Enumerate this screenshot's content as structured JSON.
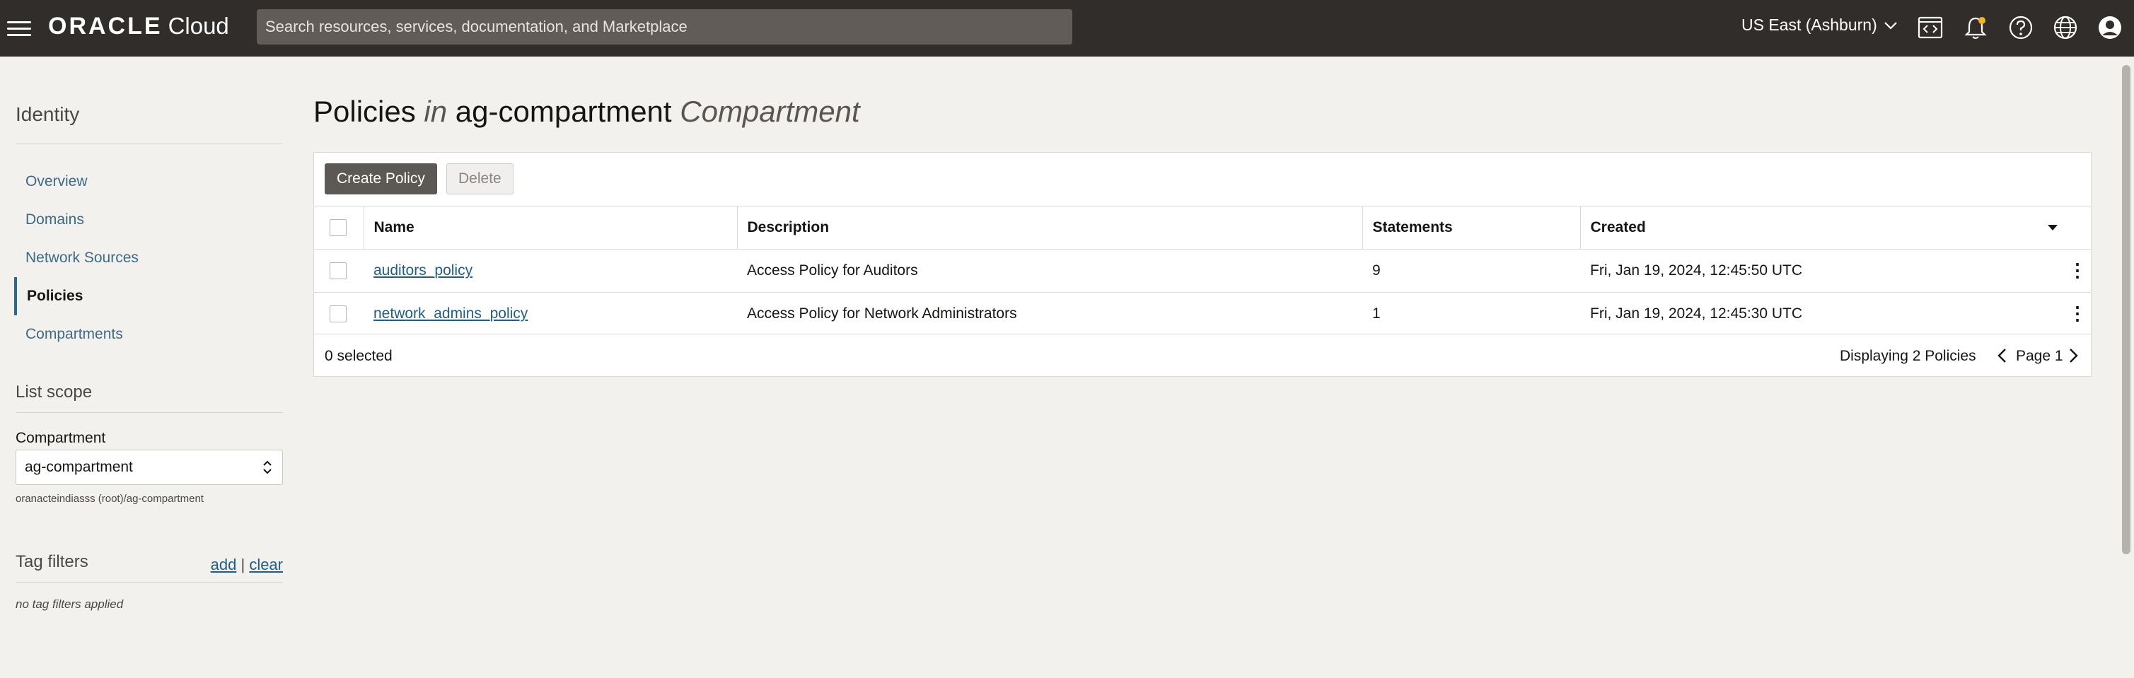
{
  "header": {
    "brand": "ORACLE",
    "cloud": "Cloud",
    "search_placeholder": "Search resources, services, documentation, and Marketplace",
    "region": "US East (Ashburn)"
  },
  "sidebar": {
    "title": "Identity",
    "items": [
      {
        "label": "Overview"
      },
      {
        "label": "Domains"
      },
      {
        "label": "Network Sources"
      },
      {
        "label": "Policies"
      },
      {
        "label": "Compartments"
      }
    ],
    "list_scope_label": "List scope",
    "compartment_label": "Compartment",
    "compartment_value": "ag-compartment",
    "compartment_path": "oranacteindiasss (root)/ag-compartment",
    "tag_filters_label": "Tag filters",
    "tag_add": "add",
    "tag_sep": "|",
    "tag_clear": "clear",
    "tag_note": "no tag filters applied"
  },
  "main": {
    "title_a": "Policies",
    "title_in": "in",
    "title_b": "ag-compartment",
    "title_c": "Compartment",
    "create_button": "Create Policy",
    "delete_button": "Delete",
    "columns": {
      "name": "Name",
      "description": "Description",
      "statements": "Statements",
      "created": "Created"
    },
    "rows": [
      {
        "name": "auditors_policy",
        "description": "Access Policy for Auditors",
        "statements": "9",
        "created": "Fri, Jan 19, 2024, 12:45:50 UTC"
      },
      {
        "name": "network_admins_policy",
        "description": "Access Policy for Network Administrators",
        "statements": "1",
        "created": "Fri, Jan 19, 2024, 12:45:30 UTC"
      }
    ],
    "selected_count": "0 selected",
    "displaying": "Displaying 2 Policies",
    "page": "Page 1"
  }
}
